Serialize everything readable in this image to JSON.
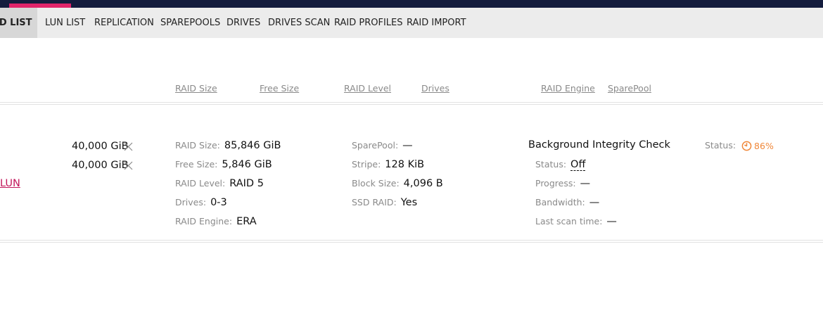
{
  "tabs": [
    {
      "label": "ID LIST",
      "active": true
    },
    {
      "label": "LUN LIST"
    },
    {
      "label": "REPLICATION"
    },
    {
      "label": "SPAREPOOLS"
    },
    {
      "label": "DRIVES"
    },
    {
      "label": "DRIVES SCAN"
    },
    {
      "label": "RAID PROFILES"
    },
    {
      "label": "RAID IMPORT"
    }
  ],
  "columns": [
    "RAID Size",
    "Free Size",
    "RAID Level",
    "Drives",
    "RAID Engine",
    "SparePool"
  ],
  "row": {
    "luns": [
      {
        "size": "40,000 GiB",
        "icon": "close-icon"
      },
      {
        "size": "40,000 GiB",
        "icon": "close-icon"
      }
    ],
    "create_lun_link": "LUN",
    "details_left": [
      {
        "key": "RAID Size:",
        "value": "85,846 GiB"
      },
      {
        "key": "Free Size:",
        "value": "5,846 GiB"
      },
      {
        "key": "RAID Level:",
        "value": "RAID 5"
      },
      {
        "key": "Drives:",
        "value": "0-3"
      },
      {
        "key": "RAID Engine:",
        "value": "ERA"
      }
    ],
    "details_middle": [
      {
        "key": "SparePool:",
        "value": "—"
      },
      {
        "key": "Stripe:",
        "value": "128 KiB"
      },
      {
        "key": "Block Size:",
        "value": "4,096 B"
      },
      {
        "key": "SSD RAID:",
        "value": "Yes"
      }
    ],
    "bic": {
      "title": "Background Integrity Check",
      "items": [
        {
          "key": "Status:",
          "value": "Off"
        },
        {
          "key": "Progress:",
          "value": "—"
        },
        {
          "key": "Bandwidth:",
          "value": "—"
        },
        {
          "key": "Last scan time:",
          "value": "—"
        }
      ]
    },
    "status": {
      "label": "Status:",
      "percent_text": "86%",
      "percent_value": 86,
      "icon": "progress-ring-icon",
      "color": "#f0883a"
    }
  },
  "colors": {
    "topbar": "#141c3d",
    "accent": "#e0246a",
    "tabs_bg": "#ececec",
    "link": "#c2185b"
  }
}
